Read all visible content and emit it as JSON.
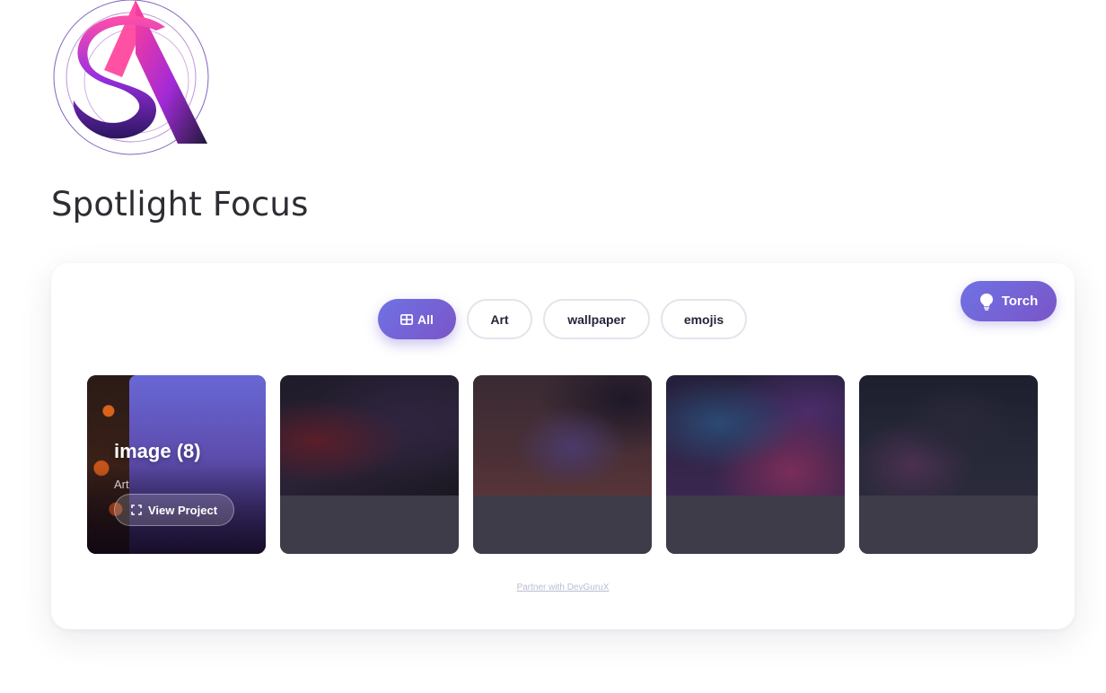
{
  "brand": {
    "logo_text": "SA"
  },
  "page": {
    "title": "Spotlight Focus"
  },
  "toolbar": {
    "torch_label": "Torch"
  },
  "filters": [
    {
      "label": "All",
      "active": true
    },
    {
      "label": "Art",
      "active": false
    },
    {
      "label": "wallpaper",
      "active": false
    },
    {
      "label": "emojis",
      "active": false
    }
  ],
  "gallery": {
    "featured": {
      "title": "image (8)",
      "category": "Art",
      "action_label": "View Project"
    }
  },
  "footer": {
    "link_text": "Partner with DevGuruX"
  },
  "colors": {
    "accent_start": "#6f72e4",
    "accent_end": "#7a55c8",
    "text": "#2d2d33"
  }
}
